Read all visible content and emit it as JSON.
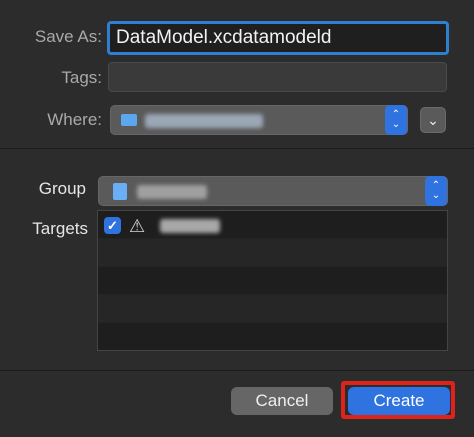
{
  "save_as": {
    "label": "Save As:",
    "value": "DataModel.xcdatamodeld"
  },
  "tags": {
    "label": "Tags:",
    "value": ""
  },
  "where": {
    "label": "Where:"
  },
  "group": {
    "label": "Group"
  },
  "targets": {
    "label": "Targets",
    "rows": [
      {
        "checked": true
      }
    ]
  },
  "buttons": {
    "cancel": "Cancel",
    "create": "Create"
  },
  "colors": {
    "accent": "#2f73e0",
    "highlight": "#e0221c"
  },
  "icons": {
    "stepper": "up-down-chevron-icon",
    "disclosure": "chevron-down-icon",
    "checkbox": "checkmark-icon",
    "app": "xcode-app-icon",
    "folder": "folder-icon"
  }
}
